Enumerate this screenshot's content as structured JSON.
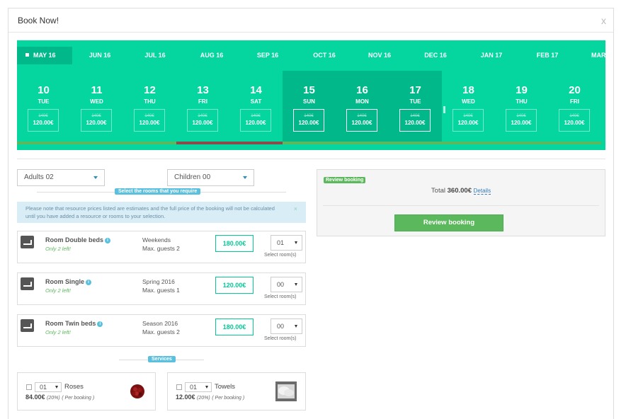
{
  "modal": {
    "title": "Book Now!",
    "close": "x"
  },
  "calendar": {
    "months": [
      "MAY 16",
      "JUN 16",
      "JUL 16",
      "AUG 16",
      "SEP 16",
      "OCT 16",
      "NOV 16",
      "DEC 16",
      "JAN 17",
      "FEB 17",
      "MAR"
    ],
    "active_month": "MAY 16",
    "days": [
      {
        "num": "10",
        "name": "TUE",
        "old": "140€",
        "price": "120.00€",
        "selected": false,
        "status": "available"
      },
      {
        "num": "11",
        "name": "WED",
        "old": "140€",
        "price": "120.00€",
        "selected": false,
        "status": "available"
      },
      {
        "num": "12",
        "name": "THU",
        "old": "140€",
        "price": "120.00€",
        "selected": false,
        "status": "available"
      },
      {
        "num": "13",
        "name": "FRI",
        "old": "140€",
        "price": "120.00€",
        "selected": false,
        "status": "busy"
      },
      {
        "num": "14",
        "name": "SAT",
        "old": "140€",
        "price": "120.00€",
        "selected": false,
        "status": "busy"
      },
      {
        "num": "15",
        "name": "SUN",
        "old": "140€",
        "price": "120.00€",
        "selected": true,
        "status": "available"
      },
      {
        "num": "16",
        "name": "MON",
        "old": "140€",
        "price": "120.00€",
        "selected": true,
        "status": "available"
      },
      {
        "num": "17",
        "name": "TUE",
        "old": "140€",
        "price": "120.00€",
        "selected": true,
        "status": "available"
      },
      {
        "num": "18",
        "name": "WED",
        "old": "140€",
        "price": "120.00€",
        "selected": false,
        "status": "available"
      },
      {
        "num": "19",
        "name": "THU",
        "old": "140€",
        "price": "120.00€",
        "selected": false,
        "status": "available"
      },
      {
        "num": "20",
        "name": "FRI",
        "old": "140€",
        "price": "120.00€",
        "selected": false,
        "status": "available"
      }
    ],
    "colors": {
      "background": "#05d6a0",
      "selected": "#00b88a",
      "available_bar": "#5cb85c",
      "busy_bar": "#8a4b4b"
    }
  },
  "filters": {
    "adults": "Adults 02",
    "children": "Children 00"
  },
  "rooms_section": {
    "title": "Select the rooms that you require",
    "notice": "Please note that resource prices listed are estimates and the full price of the booking will not be calculated until you have added a resource or rooms to your selection.",
    "notice_close": "×"
  },
  "rooms": [
    {
      "name": "Room Double beds",
      "availability": "Only 2 left!",
      "season": "Weekends",
      "guests": "Max. guests 2",
      "price": "180.00€",
      "qty": "01",
      "qty_label": "Select room(s)"
    },
    {
      "name": "Room Single",
      "availability": "Only 2 left!",
      "season": "Spring 2016",
      "guests": "Max. guests 1",
      "price": "120.00€",
      "qty": "00",
      "qty_label": "Select room(s)"
    },
    {
      "name": "Room Twin beds",
      "availability": "Only 2 left!",
      "season": "Season 2016",
      "guests": "Max. guests 2",
      "price": "180.00€",
      "qty": "00",
      "qty_label": "Select room(s)"
    }
  ],
  "services_section": {
    "title": "Services"
  },
  "services": [
    {
      "name": "Roses",
      "qty": "01",
      "price": "84.00€",
      "tax": "(20%)",
      "per": "( Per booking )",
      "image": "roses-image"
    },
    {
      "name": "Towels",
      "qty": "01",
      "price": "12.00€",
      "tax": "(20%)",
      "per": "( Per booking )",
      "image": "towels-image"
    }
  ],
  "review": {
    "badge": "Review booking",
    "total_label": "Total",
    "total_value": "360.00€",
    "details_link": "Details",
    "button": "Review booking"
  }
}
